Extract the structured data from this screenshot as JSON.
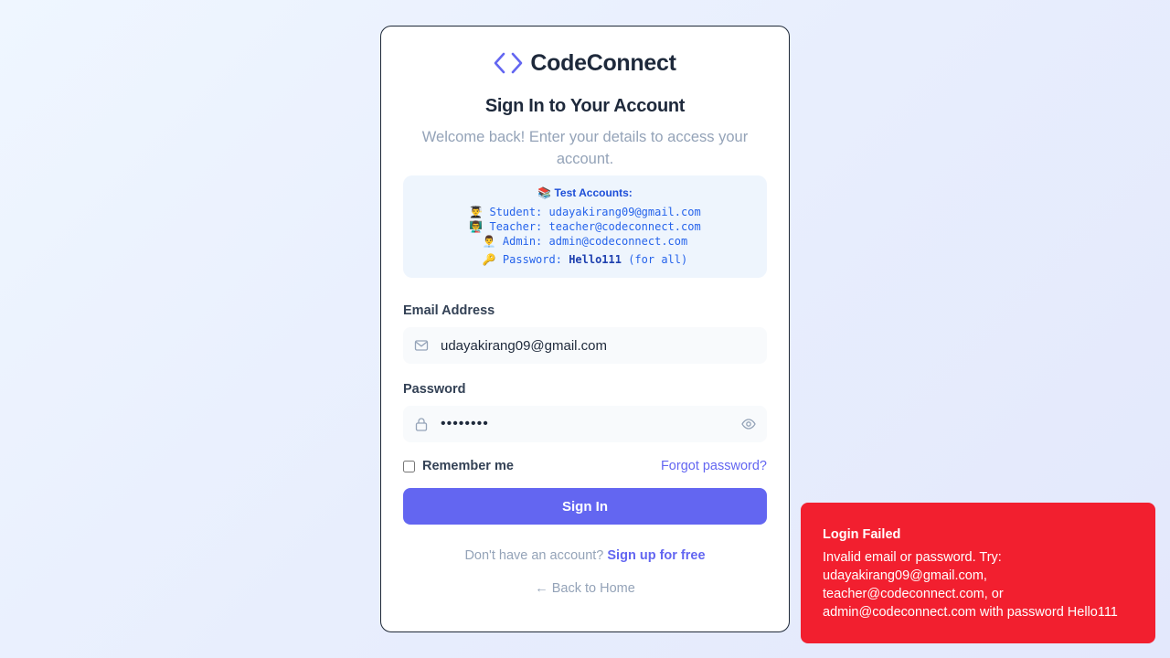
{
  "brand": {
    "name": "CodeConnect",
    "accent_color": "#6366f1",
    "logo_icon": "code-brackets-icon"
  },
  "header": {
    "title": "Sign In to Your Account",
    "subtitle": "Welcome back! Enter your details to access your account."
  },
  "test_accounts": {
    "title": "📚 Test Accounts:",
    "student": "👨‍🎓 Student: udayakirang09@gmail.com",
    "teacher": "👨‍🏫 Teacher: teacher@codeconnect.com",
    "admin": "👨‍💼 Admin: admin@codeconnect.com",
    "password_prefix": "🔑 Password: ",
    "password_value": "Hello111",
    "password_suffix": " (for all)"
  },
  "form": {
    "email_label": "Email Address",
    "email_value": "udayakirang09@gmail.com",
    "password_label": "Password",
    "password_value": "Hello111",
    "remember_label": "Remember me",
    "remember_checked": false,
    "forgot_label": "Forgot password?",
    "submit_label": "Sign In"
  },
  "footer": {
    "signup_prompt": "Don't have an account? ",
    "signup_link": "Sign up for free",
    "back_link": "← Back to Home"
  },
  "toast": {
    "title": "Login Failed",
    "message": "Invalid email or password. Try: udayakirang09@gmail.com, teacher@codeconnect.com, or admin@codeconnect.com with password Hello111",
    "color": "#f21f2f"
  }
}
